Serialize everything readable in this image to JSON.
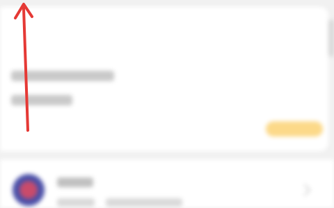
{
  "top_card": {
    "title": "",
    "line1": "",
    "line2": "",
    "action_label": ""
  },
  "list_item": {
    "name": "",
    "meta1": "",
    "meta2": ""
  },
  "overlay": {
    "arrow_color": "#e53935",
    "arrow_direction": "up"
  },
  "colors": {
    "accent_button": "#fcd989",
    "background": "#f1f1f1",
    "card": "#ffffff"
  }
}
